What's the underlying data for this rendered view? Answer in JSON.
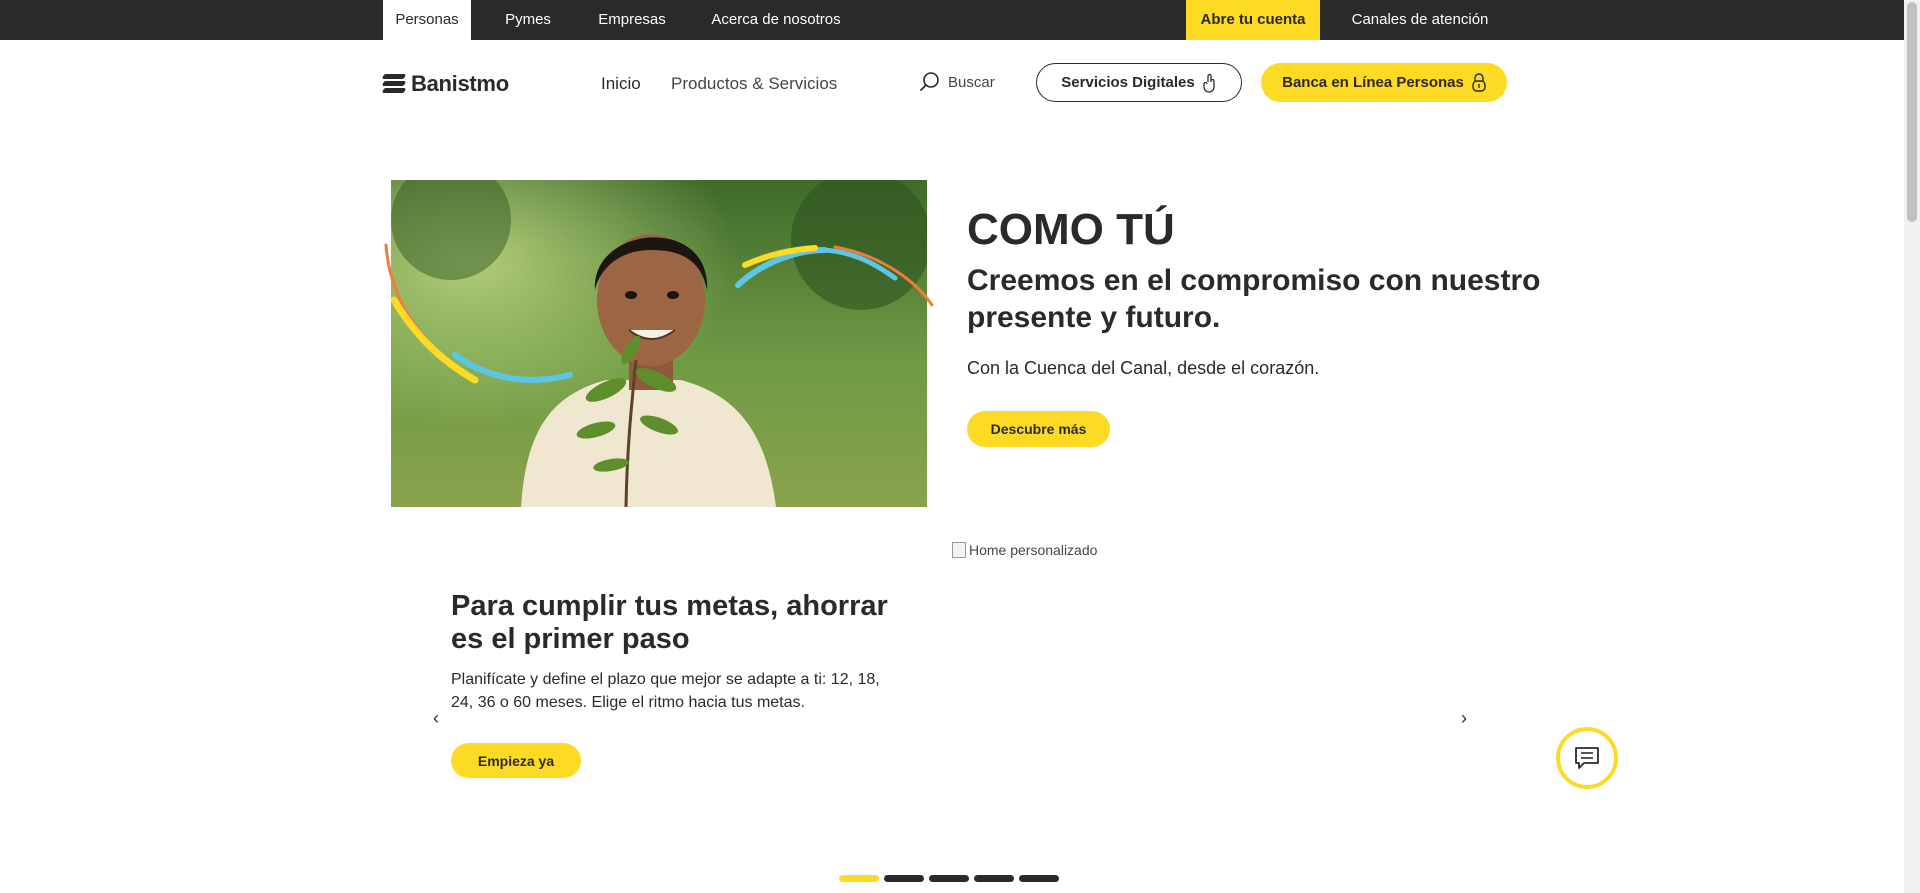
{
  "topbar": {
    "tabs": [
      "Personas",
      "Pymes",
      "Empresas",
      "Acerca de nosotros"
    ],
    "cta": "Abre tu cuenta",
    "channels": "Canales de atención"
  },
  "header": {
    "logo": "Banistmo",
    "nav": [
      "Inicio",
      "Productos & Servicios"
    ],
    "search_label": "Buscar",
    "digital_services": "Servicios Digitales",
    "online_banking": "Banca en Línea Personas"
  },
  "hero": {
    "title": "COMO TÚ",
    "subtitle": "Creemos en el compromiso con nuestro presente y futuro.",
    "text": "Con la Cuenca del Canal, desde el corazón.",
    "button": "Descubre más"
  },
  "carousel": {
    "image_alt": "Home personalizado",
    "title": "Para cumplir tus metas, ahorrar es el primer paso",
    "text": "Planifícate y define el plazo que mejor se adapte a ti: 12, 18, 24, 36 o 60 meses. Elige el ritmo hacia tus metas.",
    "button": "Empieza ya",
    "prev": "‹",
    "next": "›",
    "active_slide": 1,
    "slide_count": 5
  },
  "colors": {
    "brand_yellow": "#fdda24",
    "dark": "#2c2a29"
  }
}
